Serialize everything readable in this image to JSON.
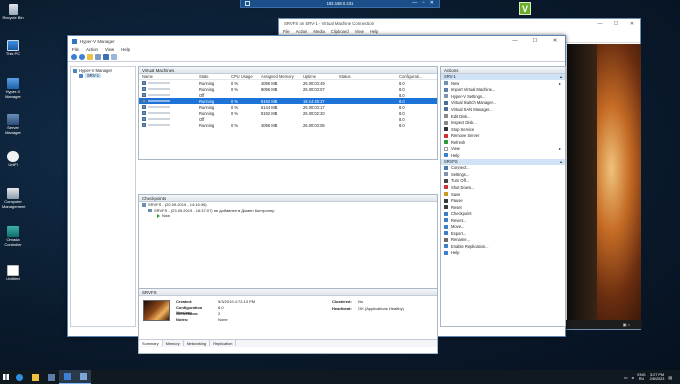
{
  "desktop": {
    "rdp_bar_title": "192.168.0.231",
    "rdp_controls": "— ▫ ✕",
    "icons": [
      {
        "label": "Recycle Bin",
        "icon": "recycle-bin-icon"
      },
      {
        "label": "This PC",
        "icon": "this-pc-icon"
      },
      {
        "label": "Hyper-V Manager",
        "icon": "hyper-v-icon"
      },
      {
        "label": "Server Manager",
        "icon": "server-manager-icon"
      },
      {
        "label": "UniFi",
        "icon": "unifi-icon"
      },
      {
        "label": "Computer Management",
        "icon": "computer-management-icon"
      },
      {
        "label": "Omada Controller",
        "icon": "omada-icon"
      },
      {
        "label": "Untitled",
        "icon": "document-icon"
      }
    ],
    "v_icon_text": "V"
  },
  "vm_connection": {
    "title": "SRVFS on SRV-1 - Virtual Machine Connection",
    "menu": [
      "File",
      "Action",
      "Media",
      "Clipboard",
      "View",
      "Help"
    ],
    "window_controls": [
      "—",
      "☐",
      "✕"
    ]
  },
  "hyperv": {
    "title": "Hyper-V Manager",
    "window_controls": [
      "—",
      "☐",
      "✕"
    ],
    "menu": [
      "File",
      "Action",
      "View",
      "Help"
    ],
    "tree": {
      "root": "Hyper-V Manager",
      "server": "SRV-1"
    },
    "vm_panel": {
      "title": "Virtual Machines",
      "columns": [
        "Name",
        "State",
        "CPU Usage",
        "Assigned Memory",
        "Uptime",
        "Status",
        "Configurati..."
      ],
      "rows": [
        {
          "state": "Running",
          "cpu": "0 %",
          "mem": "4096 MB",
          "uptime": "26.00:03:49",
          "status": "",
          "cfg": "8.0",
          "selected": false
        },
        {
          "state": "Running",
          "cpu": "0 %",
          "mem": "8096 MB",
          "uptime": "26.00:03:07",
          "status": "",
          "cfg": "8.0",
          "selected": false
        },
        {
          "state": "Off",
          "cpu": "",
          "mem": "",
          "uptime": "",
          "status": "",
          "cfg": "8.0",
          "selected": false
        },
        {
          "state": "Running",
          "cpu": "0 %",
          "mem": "8192 MB",
          "uptime": "19.14:45:37",
          "status": "",
          "cfg": "8.0",
          "selected": true
        },
        {
          "state": "Running",
          "cpu": "0 %",
          "mem": "6144 MB",
          "uptime": "26.00:03:17",
          "status": "",
          "cfg": "8.0",
          "selected": false
        },
        {
          "state": "Running",
          "cpu": "0 %",
          "mem": "8192 MB",
          "uptime": "26.00:02:20",
          "status": "",
          "cfg": "8.0",
          "selected": false
        },
        {
          "state": "Off",
          "cpu": "",
          "mem": "",
          "uptime": "",
          "status": "",
          "cfg": "8.0",
          "selected": false
        },
        {
          "state": "Running",
          "cpu": "0 %",
          "mem": "4096 MB",
          "uptime": "26.00:03:05",
          "status": "",
          "cfg": "8.0",
          "selected": false
        }
      ]
    },
    "checkpoints": {
      "title": "Checkpoints",
      "items": [
        {
          "level": 1,
          "text": "SRVFS - (20.09.2019 - 14:15:36)"
        },
        {
          "level": 2,
          "text": "SRVFS - (23.09.2019 - 16:37:07) не добавлен в Домен Контролер"
        },
        {
          "level": 3,
          "text": "Now"
        }
      ]
    },
    "details": {
      "title": "SRVFS",
      "fields": {
        "created_k": "Created:",
        "created_v": "9/3/2019 4:72:13 PM",
        "cfgver_k": "Configuration Version:",
        "cfgver_v": "8.0",
        "gen_k": "Generation:",
        "gen_v": "2",
        "notes_k": "Notes:",
        "notes_v": "None",
        "clustered_k": "Clustered:",
        "clustered_v": "No",
        "heartbeat_k": "Heartbeat:",
        "heartbeat_v": "OK (Applications Healthy)"
      },
      "tabs": [
        "Summary",
        "Memory",
        "Networking",
        "Replication"
      ]
    },
    "actions": {
      "title": "Actions",
      "group1": "SRV-1",
      "group1_items": [
        {
          "label": "New",
          "icon": "new-icon",
          "color": "#6a8fb5",
          "arrow": "▸"
        },
        {
          "label": "Import Virtual Machine...",
          "icon": "import-icon",
          "color": "#5b7fa8",
          "arrow": ""
        },
        {
          "label": "Hyper-V Settings...",
          "icon": "settings-icon",
          "color": "#7d93ad",
          "arrow": ""
        },
        {
          "label": "Virtual Switch Manager...",
          "icon": "switch-icon",
          "color": "#4a6e95",
          "arrow": ""
        },
        {
          "label": "Virtual SAN Manager...",
          "icon": "san-icon",
          "color": "#4a6e95",
          "arrow": ""
        },
        {
          "label": "Edit Disk...",
          "icon": "edit-disk-icon",
          "color": "#8a8a8a",
          "arrow": ""
        },
        {
          "label": "Inspect Disk...",
          "icon": "inspect-disk-icon",
          "color": "#8a8a8a",
          "arrow": ""
        },
        {
          "label": "Stop Service",
          "icon": "stop-icon",
          "color": "#333333",
          "arrow": ""
        },
        {
          "label": "Remove Server",
          "icon": "remove-icon",
          "color": "#d03030",
          "arrow": ""
        },
        {
          "label": "Refresh",
          "icon": "refresh-icon",
          "color": "#2e9a3c",
          "arrow": ""
        },
        {
          "label": "View",
          "icon": "view-icon",
          "color": "#ffffff",
          "arrow": "▸"
        },
        {
          "label": "Help",
          "icon": "help-icon",
          "color": "#3d7fd1",
          "arrow": ""
        }
      ],
      "group2": "SRVFS",
      "group2_items": [
        {
          "label": "Connect...",
          "icon": "connect-icon",
          "color": "#4a78b0"
        },
        {
          "label": "Settings...",
          "icon": "settings-icon",
          "color": "#7d93ad"
        },
        {
          "label": "Turn Off...",
          "icon": "turn-off-icon",
          "color": "#444444"
        },
        {
          "label": "Shut Down...",
          "icon": "shut-down-icon",
          "color": "#d03030"
        },
        {
          "label": "Save",
          "icon": "save-icon",
          "color": "#c89a20"
        },
        {
          "label": "Pause",
          "icon": "pause-icon",
          "color": "#3a3a3a"
        },
        {
          "label": "Reset",
          "icon": "reset-icon",
          "color": "#3a3a3a"
        },
        {
          "label": "Checkpoint",
          "icon": "checkpoint-icon",
          "color": "#3a7dc8"
        },
        {
          "label": "Revert...",
          "icon": "revert-icon",
          "color": "#3a7dc8"
        },
        {
          "label": "Move...",
          "icon": "move-icon",
          "color": "#3a7dc8"
        },
        {
          "label": "Export...",
          "icon": "export-icon",
          "color": "#3a7dc8"
        },
        {
          "label": "Rename...",
          "icon": "rename-icon",
          "color": "#6a6a6a"
        },
        {
          "label": "Enable Replication...",
          "icon": "replication-icon",
          "color": "#3a7dc8"
        },
        {
          "label": "Help",
          "icon": "help-icon",
          "color": "#3d7fd1"
        }
      ]
    }
  },
  "taskbar": {
    "tray_lang": "ENG",
    "tray_region": "RU",
    "time": "3:27 PM",
    "date": "2/8/2023"
  }
}
